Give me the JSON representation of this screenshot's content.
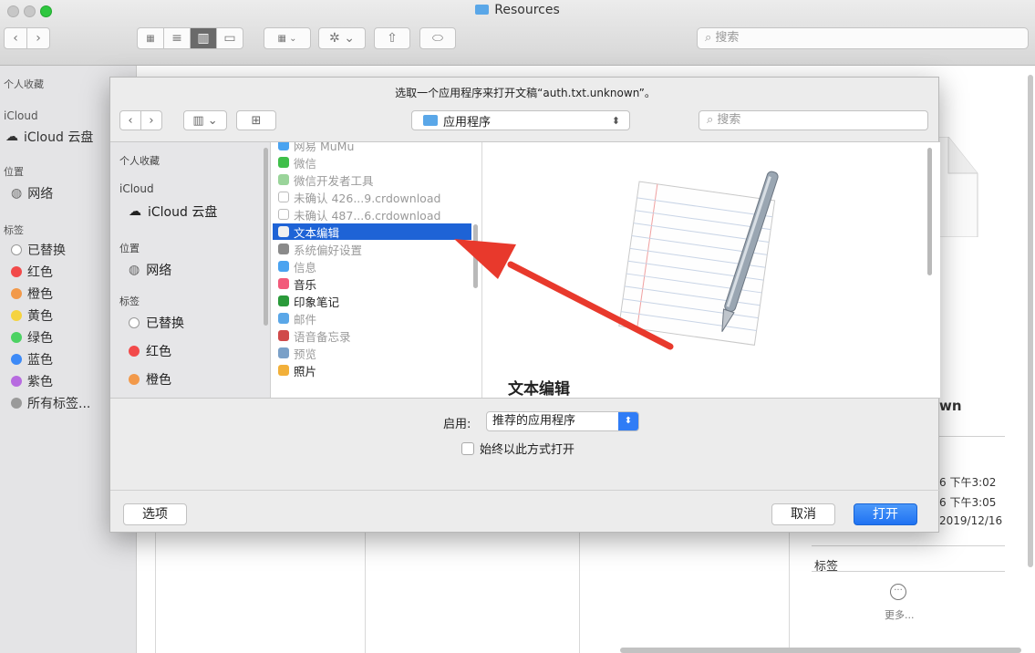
{
  "finder": {
    "title": "Resources",
    "search_placeholder": "搜索",
    "sidebar": {
      "favorites_header": "个人收藏",
      "icloud_header": "iCloud",
      "icloud_drive": "iCloud 云盘",
      "locations_header": "位置",
      "network": "网络",
      "tags_header": "标签",
      "tags": [
        {
          "label": "已替换",
          "color": "#ffffff"
        },
        {
          "label": "红色",
          "color": "#f24a4a"
        },
        {
          "label": "橙色",
          "color": "#f2994a"
        },
        {
          "label": "黄色",
          "color": "#f5d33f"
        },
        {
          "label": "绿色",
          "color": "#4cd263"
        },
        {
          "label": "蓝色",
          "color": "#3d8af7"
        },
        {
          "label": "紫色",
          "color": "#b76be0"
        },
        {
          "label": "所有标签...",
          "color": "#9a9a9a"
        }
      ]
    },
    "info": {
      "name_fragment": "wn",
      "date1": "6 下午3:02",
      "date2": "6 下午3:05",
      "date3": "2019/12/16",
      "tags_label": "标签",
      "more": "更多..."
    }
  },
  "dialog": {
    "message": "选取一个应用程序来打开文稿“auth.txt.unknown”。",
    "location": "应用程序",
    "search_placeholder": "搜索",
    "sidebar": {
      "favorites_header": "个人收藏",
      "icloud_header": "iCloud",
      "icloud_drive": "iCloud 云盘",
      "locations_header": "位置",
      "network": "网络",
      "tags_header": "标签",
      "tags": [
        {
          "label": "已替换",
          "color": "#ffffff"
        },
        {
          "label": "红色",
          "color": "#f24a4a"
        },
        {
          "label": "橙色",
          "color": "#f2994a"
        }
      ]
    },
    "apps": [
      {
        "label": "网易 MuMu",
        "icon_color": "#4aa3f0",
        "dim": true
      },
      {
        "label": "微信",
        "icon_color": "#3fbf4a",
        "dim": true
      },
      {
        "label": "微信开发者工具",
        "icon_color": "#9ad49a",
        "dim": true
      },
      {
        "label": "未确认 426...9.crdownload",
        "icon_color": "#ffffff",
        "dim": true
      },
      {
        "label": "未确认 487...6.crdownload",
        "icon_color": "#ffffff",
        "dim": true
      },
      {
        "label": "文本编辑",
        "icon_color": "#f0f0f0",
        "dim": false,
        "selected": true
      },
      {
        "label": "系统偏好设置",
        "icon_color": "#8a8a8a",
        "dim": true
      },
      {
        "label": "信息",
        "icon_color": "#4aa3f0",
        "dim": true
      },
      {
        "label": "音乐",
        "icon_color": "#f25a7a",
        "dim": false
      },
      {
        "label": "印象笔记",
        "icon_color": "#2a9a3a",
        "dim": false
      },
      {
        "label": "邮件",
        "icon_color": "#5aa7e8",
        "dim": true
      },
      {
        "label": "语音备忘录",
        "icon_color": "#d04a4a",
        "dim": true
      },
      {
        "label": "预览",
        "icon_color": "#7aa0c8",
        "dim": true
      },
      {
        "label": "照片",
        "icon_color": "#f2b03a",
        "dim": false
      }
    ],
    "preview_name": "文本编辑",
    "enable_label": "启用:",
    "enable_value": "推荐的应用程序",
    "always_open": "始终以此方式打开",
    "options": "选项",
    "cancel": "取消",
    "open": "打开",
    "arrow_color": "#e8392c"
  }
}
